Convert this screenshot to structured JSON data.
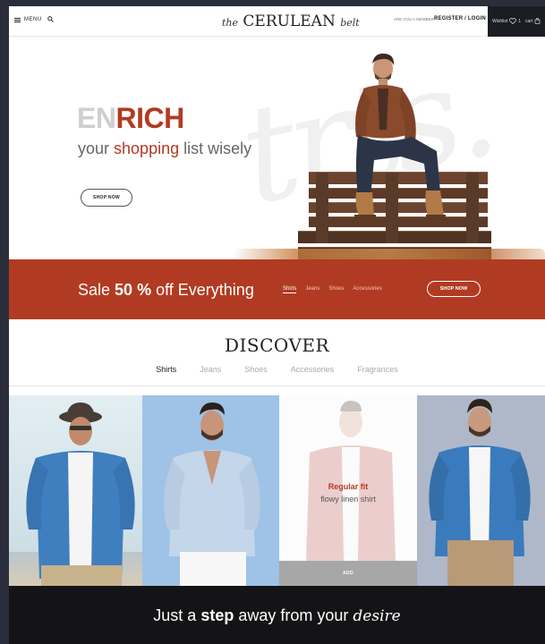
{
  "header": {
    "menu_label": "MENU",
    "logo_prefix": "the",
    "logo_name": "CERULEAN",
    "logo_suffix": "belt",
    "account_prompt": "ARE YOU A MEMBER?",
    "login_label": "REGISTER / LOGIN",
    "wishlist_label": "Wishlist",
    "wishlist_count": "1",
    "cart_label": "cart"
  },
  "hero": {
    "headline_light": "EN",
    "headline_bold": "RICH",
    "tagline_pre": "your",
    "tagline_em": "shopping",
    "tagline_post": "list wisely",
    "button_label": "SHOP NOW",
    "bg_script": "trts."
  },
  "promo": {
    "sale_pre": "Sale",
    "sale_bold": "50 %",
    "sale_post": "off Everything",
    "tabs": [
      "Shirts",
      "Jeans",
      "Shoes",
      "Accessories"
    ],
    "button_label": "SHOP NOW"
  },
  "discover": {
    "title": "DISCOVER",
    "tabs": [
      "Shirts",
      "Jeans",
      "Shoes",
      "Accessories",
      "Fragrances"
    ]
  },
  "products": {
    "featured_title": "Regular fit",
    "featured_subtitle": "flowy linen shirt",
    "add_label": "ADD"
  },
  "footer": {
    "pre": "Just a",
    "bold": "step",
    "mid": "away from your",
    "script": "desire"
  },
  "colors": {
    "accent": "#b13b22",
    "dark": "#141417",
    "frame": "#2b2e3a"
  }
}
